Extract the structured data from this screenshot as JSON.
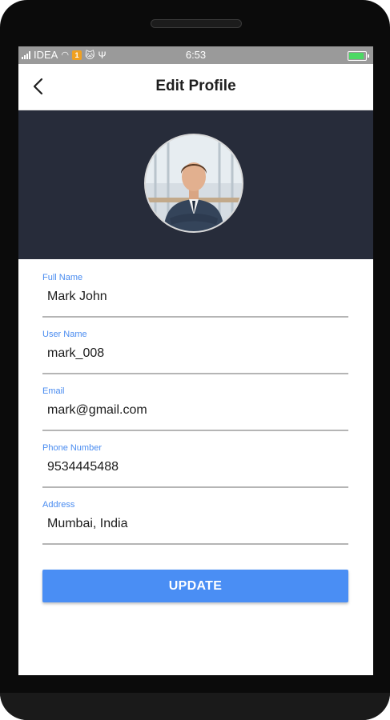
{
  "status_bar": {
    "carrier": "IDEA",
    "time": "6:53",
    "notification_badge": "1",
    "icons": [
      "signal-icon",
      "wifi-icon",
      "notification-badge-icon",
      "cat-icon",
      "usb-icon",
      "battery-icon"
    ]
  },
  "app_bar": {
    "title": "Edit Profile",
    "back_icon": "back-arrow-icon"
  },
  "profile": {
    "avatar_icon": "profile-photo"
  },
  "form": {
    "fields": [
      {
        "label": "Full Name",
        "value": "Mark John"
      },
      {
        "label": "User Name",
        "value": "mark_008"
      },
      {
        "label": "Email",
        "value": "mark@gmail.com"
      },
      {
        "label": "Phone Number",
        "value": "9534445488"
      },
      {
        "label": "Address",
        "value": "Mumbai, India"
      }
    ],
    "submit_label": "UPDATE"
  },
  "colors": {
    "accent": "#4a8ef4",
    "label": "#4a8cf0",
    "header_bg": "#272c3a"
  }
}
